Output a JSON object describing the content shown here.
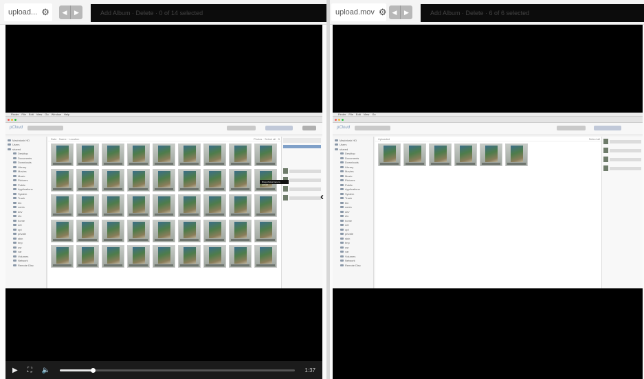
{
  "left": {
    "tab_label": "upload...",
    "darkstrip_text": "Add Album · Delete · 0 of 14 selected",
    "app": {
      "menu": [
        "Finder",
        "File",
        "Edit",
        "View",
        "Go",
        "Window",
        "Help"
      ],
      "window_title": "",
      "logo": "pCloud",
      "toolbar_text": "Download",
      "content_bar": {
        "left": "Date · Name · Location",
        "right": "Photos · Select all · 5"
      },
      "sidebar_items": [
        "Macintosh HD",
        "Users",
        "shared",
        "Desktop",
        "Documents",
        "Downloads",
        "Library",
        "Movies",
        "Music",
        "Pictures",
        "Public",
        "Applications",
        "System",
        "Trash",
        "bin",
        "cores",
        "dev",
        "etc",
        "home",
        "net",
        "opt",
        "private",
        "sbin",
        "tmp",
        "usr",
        "var",
        "Volumes",
        "Network",
        "Remote Disc"
      ],
      "right_panel_title": "Upload Queue",
      "tooltip": "Drag photos here to upload"
    },
    "photo_count": 45,
    "player": {
      "play": "▶",
      "fullscreen": "⛶",
      "volume": "🔈",
      "time": "1:37",
      "progress": 0.14
    }
  },
  "right": {
    "tab_label": "upload.mov",
    "darkstrip_text": "Add Album · Delete · 6 of 6 selected",
    "app": {
      "logo": "pCloud",
      "content_bar": {
        "left": "Uploaded",
        "right": "Select all"
      },
      "sidebar_items": [
        "Macintosh HD",
        "Users",
        "shared",
        "Desktop",
        "Documents",
        "Downloads",
        "Library",
        "Movies",
        "Music",
        "Pictures",
        "Public",
        "Applications",
        "System",
        "Trash",
        "bin",
        "cores",
        "dev",
        "etc",
        "home",
        "net",
        "opt",
        "private",
        "sbin",
        "tmp",
        "usr",
        "var",
        "Volumes",
        "Network",
        "Remote Disc"
      ]
    },
    "photo_count": 6
  },
  "icons": {
    "gear": "gear-icon",
    "close": "close-icon",
    "back": "back-arrow-icon",
    "forward": "forward-arrow-icon",
    "collapse": "chevron-left-icon"
  },
  "colors": {
    "background": "#d8d8d8",
    "video_bg": "#000000",
    "controls_bg": "#1b1b1b"
  }
}
